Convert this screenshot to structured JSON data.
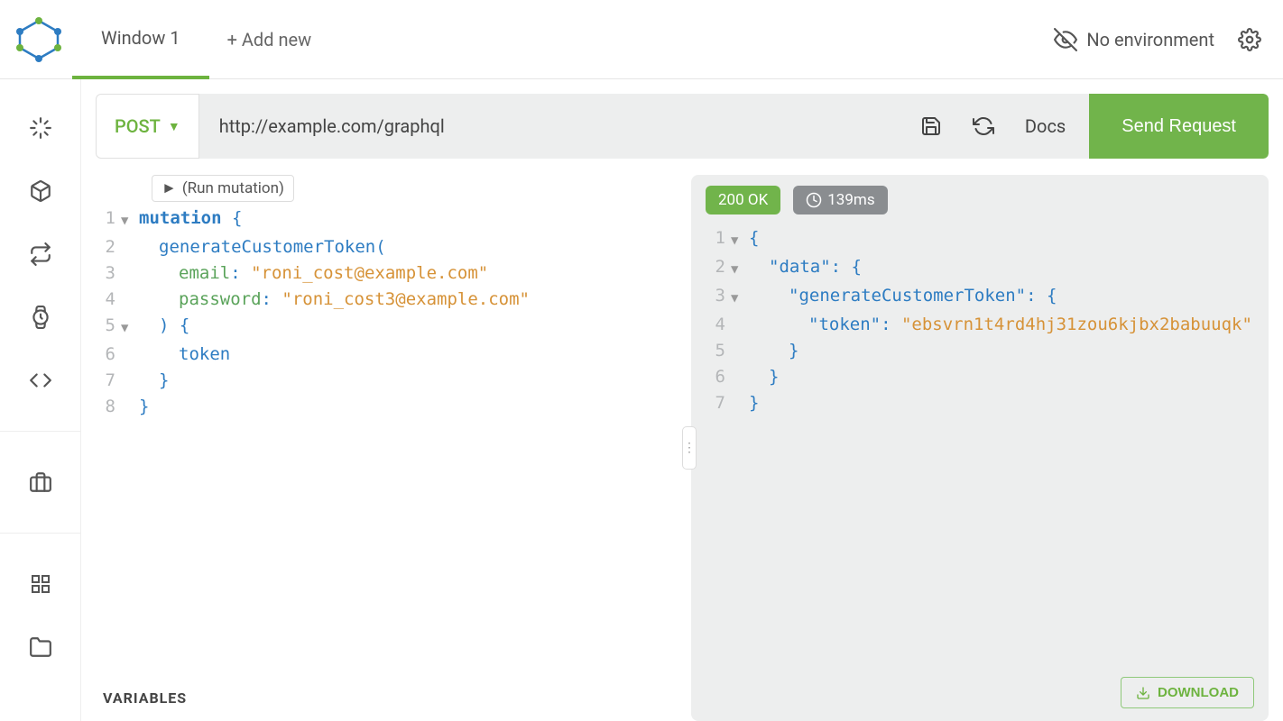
{
  "topbar": {
    "tab_label": "Window 1",
    "add_new_label": "+ Add new",
    "env_label": "No environment"
  },
  "urlbar": {
    "method": "POST",
    "url": "http://example.com/graphql",
    "docs_label": "Docs",
    "send_label": "Send Request"
  },
  "run_widget_label": "(Run mutation)",
  "query": {
    "lines": [
      {
        "n": "1",
        "fold": "▼",
        "html": "<span class='kw'>mutation</span> <span class='brace'>{</span>"
      },
      {
        "n": "2",
        "fold": "",
        "html": "<span class='indent i1'></span><span class='field'>generateCustomerToken</span><span class='punct'>(</span>"
      },
      {
        "n": "3",
        "fold": "",
        "html": "<span class='indent i2'></span><span class='argname'>email</span><span class='punct'>:</span> <span class='string'>\"roni_cost@example.com\"</span>"
      },
      {
        "n": "4",
        "fold": "",
        "html": "<span class='indent i2'></span><span class='argname'>password</span><span class='punct'>:</span> <span class='string'>\"roni_cost3@example.com\"</span>"
      },
      {
        "n": "5",
        "fold": "▼",
        "html": "<span class='indent i1'></span><span class='punct'>)</span> <span class='brace'>{</span>"
      },
      {
        "n": "6",
        "fold": "",
        "html": "<span class='indent i2'></span><span class='field'>token</span>"
      },
      {
        "n": "7",
        "fold": "",
        "html": "<span class='indent i1'></span><span class='brace'>}</span>"
      },
      {
        "n": "8",
        "fold": "",
        "html": "<span class='brace'>}</span>"
      }
    ]
  },
  "variables_label": "VARIABLES",
  "response": {
    "status": "200 OK",
    "time": "139ms",
    "lines": [
      {
        "n": "1",
        "fold": "▼",
        "html": "<span class='brace'>{</span>"
      },
      {
        "n": "2",
        "fold": "▼",
        "html": "<span class='indent i1'></span><span class='key'>\"data\"</span><span class='punct'>:</span> <span class='brace'>{</span>"
      },
      {
        "n": "3",
        "fold": "▼",
        "html": "<span class='indent i2'></span><span class='key'>\"generateCustomerToken\"</span><span class='punct'>:</span> <span class='brace'>{</span>"
      },
      {
        "n": "4",
        "fold": "",
        "html": "<span class='indent i3'></span><span class='key'>\"token\"</span><span class='punct'>:</span> <span class='val'>\"ebsvrn1t4rd4hj31zou6kjbx2babuuqk\"</span>"
      },
      {
        "n": "5",
        "fold": "",
        "html": "<span class='indent i2'></span><span class='brace'>}</span>"
      },
      {
        "n": "6",
        "fold": "",
        "html": "<span class='indent i1'></span><span class='brace'>}</span>"
      },
      {
        "n": "7",
        "fold": "",
        "html": "<span class='brace'>}</span>"
      }
    ]
  },
  "download_label": "DOWNLOAD"
}
